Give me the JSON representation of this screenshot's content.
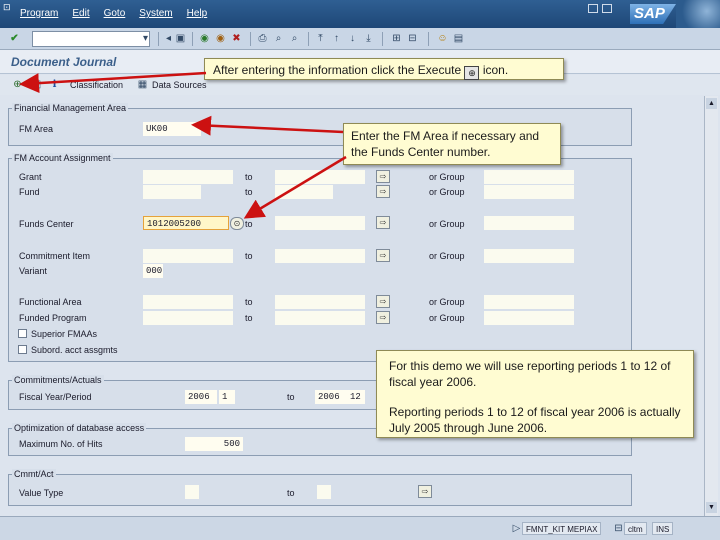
{
  "menu": {
    "items": [
      "Program",
      "Edit",
      "Goto",
      "System",
      "Help"
    ]
  },
  "brand": {
    "logo_text": "SAP"
  },
  "title": {
    "text": "Document Journal"
  },
  "app_toolbar": {
    "classification_label": "Classification",
    "data_sources_label": "Data Sources"
  },
  "groups": {
    "fm_area_group": {
      "title": "Financial Management Area",
      "fm_area_label": "FM Area",
      "fm_area_value": "UK00"
    },
    "account_assignment": {
      "title": "FM Account Assignment",
      "rows": [
        {
          "label": "Grant",
          "to": "to",
          "or_group": "or Group",
          "value": ""
        },
        {
          "label": "Fund",
          "to": "to",
          "or_group": "or Group",
          "value": ""
        },
        {
          "label": "Funds Center",
          "to": "to",
          "or_group": "or Group",
          "value": "1012005200"
        },
        {
          "label": "Commitment Item",
          "to": "to",
          "or_group": "or Group",
          "value": ""
        },
        {
          "label": "Variant",
          "value": "000"
        },
        {
          "label": "Functional Area",
          "to": "to",
          "or_group": "or Group",
          "value": ""
        },
        {
          "label": "Funded Program",
          "to": "to",
          "or_group": "or Group",
          "value": ""
        }
      ],
      "checkbox_superior": "Superior FMAAs",
      "checkbox_subord": "Subord. acct assgmts"
    },
    "commitments": {
      "title": "Commitments/Actuals",
      "fiscal_label": "Fiscal Year/Period",
      "from_year": "2006",
      "from_period": "1",
      "to_label": "to",
      "to_year": "2006",
      "to_period": "12"
    },
    "optimization": {
      "title": "Optimization of database access",
      "max_hits_label": "Maximum No. of Hits",
      "max_hits_value": "500"
    },
    "cmmt_act": {
      "title": "Cmmt/Act",
      "value_type_label": "Value Type",
      "to_label": "to"
    }
  },
  "status_bar": {
    "system": "FMNT_KIT MEPIAX",
    "server": "cltm",
    "mode": "INS"
  },
  "callouts": {
    "execute": {
      "text_before": "After entering the information click the Execute",
      "text_after": "icon."
    },
    "fm_area": {
      "text": "Enter the FM Area if necessary and the Funds Center number."
    },
    "periods": {
      "line1": "For this demo we will use reporting periods 1 to 12 of fiscal year 2006.",
      "line2": "Reporting periods 1 to 12 of fiscal year 2006 is actually July 2005 through June 2006."
    }
  },
  "colors": {
    "title_bar": "#1e4777",
    "callout_bg": "#fffcd2",
    "arrow": "#cc1111",
    "field_bg": "#fbfbef"
  }
}
